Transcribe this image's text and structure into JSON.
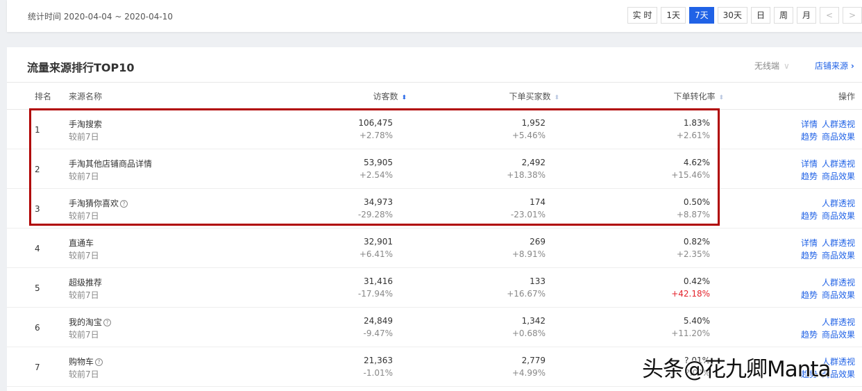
{
  "period": "统计时间 2020-04-04 ~ 2020-04-10",
  "range_buttons": [
    {
      "label": "实 时",
      "active": false
    },
    {
      "label": "1天",
      "active": false
    },
    {
      "label": "7天",
      "active": true
    },
    {
      "label": "30天",
      "active": false
    },
    {
      "label": "日",
      "active": false
    },
    {
      "label": "周",
      "active": false
    },
    {
      "label": "月",
      "active": false
    }
  ],
  "prev": "<",
  "next": ">",
  "card": {
    "title": "流量来源排行TOP10",
    "device": "无线端",
    "device_chevron": "∨",
    "store_source": "店铺来源",
    "store_chevron": "›"
  },
  "headers": {
    "rank": "排名",
    "name": "来源名称",
    "visitors": "访客数",
    "buyers": "下单买家数",
    "rate": "下单转化率",
    "action": "操作"
  },
  "compare_label": "较前7日",
  "actions": {
    "detail": "详情",
    "crowd": "人群透视",
    "trend": "趋势",
    "goods": "商品效果"
  },
  "rows": [
    {
      "rank": "1",
      "name": "手淘搜索",
      "help": false,
      "visitors": "106,475",
      "visitors_chg": "+2.78%",
      "buyers": "1,952",
      "buyers_chg": "+5.46%",
      "rate": "1.83%",
      "rate_chg": "+2.61%",
      "detail": true
    },
    {
      "rank": "2",
      "name": "手淘其他店铺商品详情",
      "help": false,
      "visitors": "53,905",
      "visitors_chg": "+2.54%",
      "buyers": "2,492",
      "buyers_chg": "+18.38%",
      "rate": "4.62%",
      "rate_chg": "+15.46%",
      "detail": true
    },
    {
      "rank": "3",
      "name": "手淘猜你喜欢",
      "help": true,
      "visitors": "34,973",
      "visitors_chg": "-29.28%",
      "buyers": "174",
      "buyers_chg": "-23.01%",
      "rate": "0.50%",
      "rate_chg": "+8.87%",
      "detail": false
    },
    {
      "rank": "4",
      "name": "直通车",
      "help": false,
      "visitors": "32,901",
      "visitors_chg": "+6.41%",
      "buyers": "269",
      "buyers_chg": "+8.91%",
      "rate": "0.82%",
      "rate_chg": "+2.35%",
      "detail": true
    },
    {
      "rank": "5",
      "name": "超级推荐",
      "help": false,
      "visitors": "31,416",
      "visitors_chg": "-17.94%",
      "buyers": "133",
      "buyers_chg": "+16.67%",
      "rate": "0.42%",
      "rate_chg": "+42.18%",
      "rate_chg_red": true,
      "detail": false
    },
    {
      "rank": "6",
      "name": "我的淘宝",
      "help": true,
      "visitors": "24,849",
      "visitors_chg": "-9.47%",
      "buyers": "1,342",
      "buyers_chg": "+0.68%",
      "rate": "5.40%",
      "rate_chg": "+11.20%",
      "detail": false
    },
    {
      "rank": "7",
      "name": "购物车",
      "help": true,
      "visitors": "21,363",
      "visitors_chg": "-1.01%",
      "buyers": "2,779",
      "buyers_chg": "+4.99%",
      "rate": "?.01%",
      "rate_chg": "?.0?%",
      "detail": false
    }
  ],
  "watermark": "头条@花九卿Manta",
  "highlight_color": "#b00000"
}
